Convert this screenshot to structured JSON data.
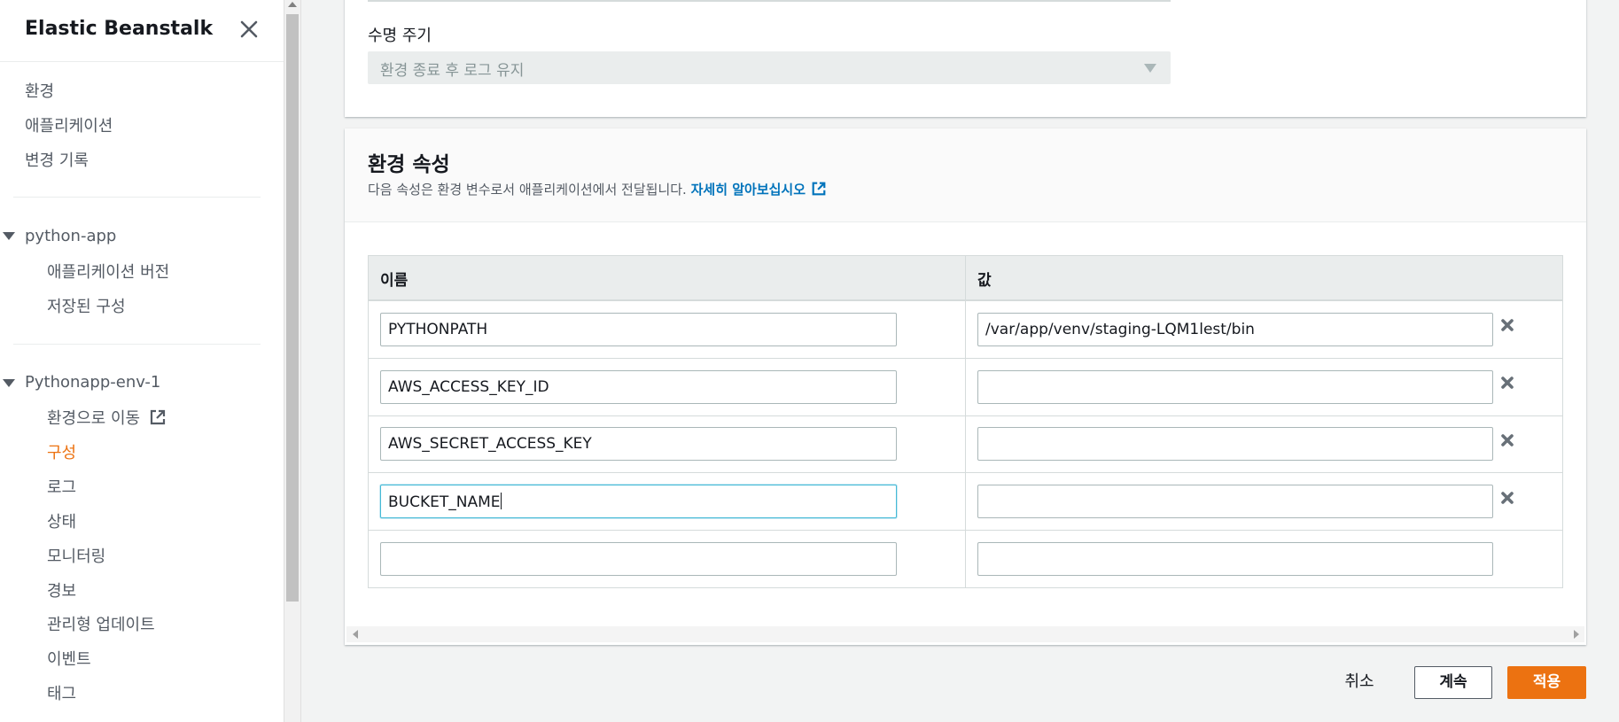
{
  "sidebar": {
    "title": "Elastic Beanstalk",
    "top_links": [
      "환경",
      "애플리케이션",
      "변경 기록"
    ],
    "app_group": {
      "label": "python-app",
      "items": [
        "애플리케이션 버전",
        "저장된 구성"
      ]
    },
    "env_group": {
      "label": "Pythonapp-env-1",
      "items": [
        "환경으로 이동",
        "구성",
        "로그",
        "상태",
        "모니터링",
        "경보",
        "관리형 업데이트",
        "이벤트",
        "태그"
      ],
      "active_item": "구성"
    }
  },
  "lifecycle": {
    "label": "수명 주기",
    "value": "환경 종료 후 로그 유지"
  },
  "env_props": {
    "title": "환경 속성",
    "description": "다음 속성은 환경 변수로서 애플리케이션에서 전달됩니다.",
    "learn_more": "자세히 알아보십시오",
    "columns": [
      "이름",
      "값"
    ],
    "rows": [
      {
        "name": "PYTHONPATH",
        "value": "/var/app/venv/staging-LQM1lest/bin"
      },
      {
        "name": "AWS_ACCESS_KEY_ID",
        "value": ""
      },
      {
        "name": "AWS_SECRET_ACCESS_KEY",
        "value": ""
      },
      {
        "name": "BUCKET_NAME",
        "value": ""
      },
      {
        "name": "",
        "value": ""
      }
    ]
  },
  "footer": {
    "cancel": "취소",
    "continue": "계속",
    "apply": "적용"
  },
  "colors": {
    "accent": "#ec7211",
    "link": "#0073bb"
  }
}
